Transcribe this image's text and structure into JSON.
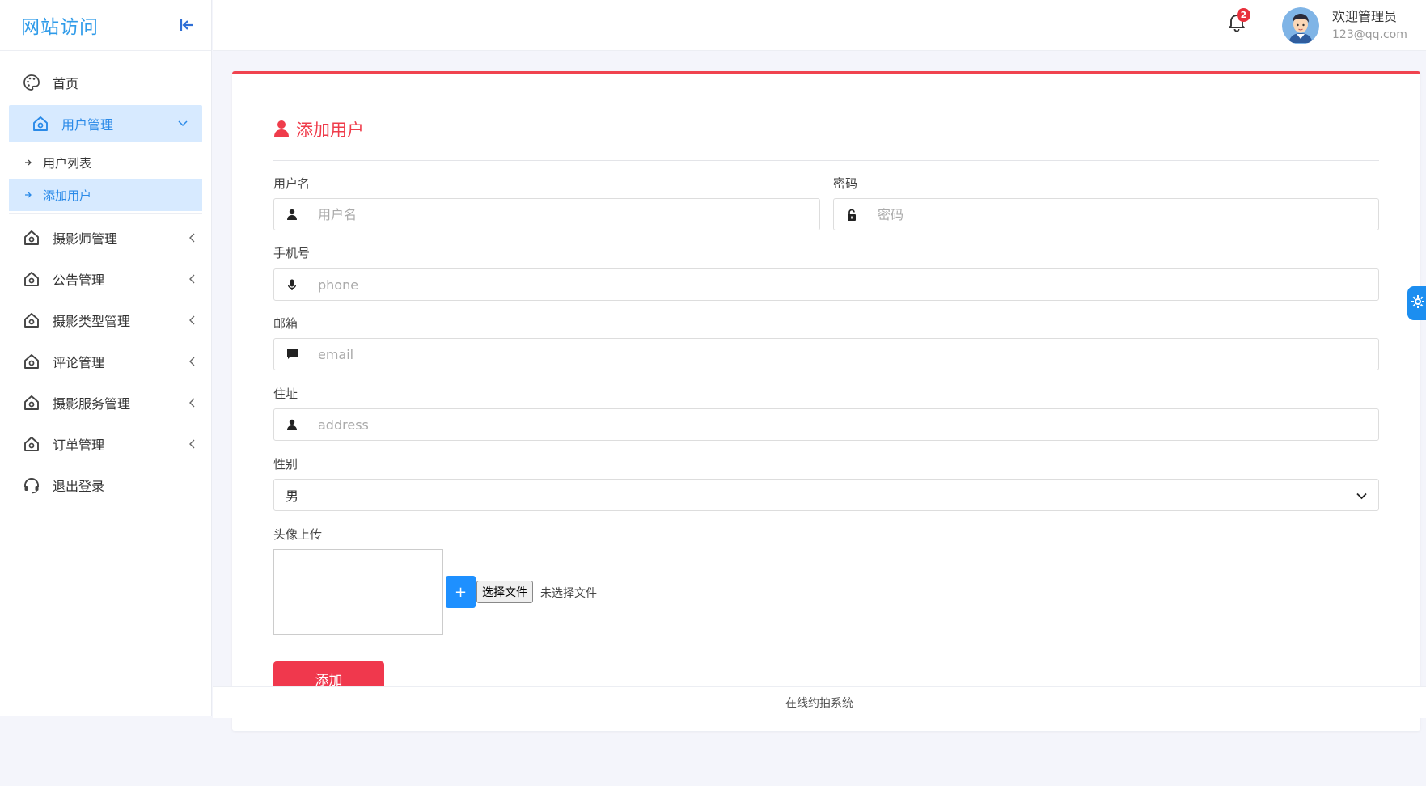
{
  "brand": {
    "title": "网站访问"
  },
  "sidebar": {
    "items": [
      {
        "label": "首页",
        "icon": "palette-icon"
      },
      {
        "label": "用户管理",
        "icon": "home-icon",
        "expanded": true,
        "children": [
          {
            "label": "用户列表"
          },
          {
            "label": "添加用户",
            "active": true
          }
        ]
      },
      {
        "label": "摄影师管理",
        "icon": "home-icon"
      },
      {
        "label": "公告管理",
        "icon": "home-icon"
      },
      {
        "label": "摄影类型管理",
        "icon": "home-icon"
      },
      {
        "label": "评论管理",
        "icon": "home-icon"
      },
      {
        "label": "摄影服务管理",
        "icon": "home-icon"
      },
      {
        "label": "订单管理",
        "icon": "home-icon"
      },
      {
        "label": "退出登录",
        "icon": "headset-icon"
      }
    ]
  },
  "header": {
    "notifications": "2",
    "user": {
      "name": "欢迎管理员",
      "email": "123@qq.com"
    }
  },
  "form": {
    "title": "添加用户",
    "username": {
      "label": "用户名",
      "placeholder": "用户名"
    },
    "password": {
      "label": "密码",
      "placeholder": "密码"
    },
    "phone": {
      "label": "手机号",
      "placeholder": "phone"
    },
    "email": {
      "label": "邮箱",
      "placeholder": "email"
    },
    "address": {
      "label": "住址",
      "placeholder": "address"
    },
    "gender": {
      "label": "性别",
      "value": "男"
    },
    "avatar": {
      "label": "头像上传",
      "plus": "+",
      "choose_file": "选择文件",
      "no_file": "未选择文件"
    },
    "submit": "添加"
  },
  "footer": {
    "text": "在线约拍系统"
  },
  "colors": {
    "accent_red": "#f0384d",
    "accent_blue": "#2f9be9",
    "active_bg": "#d7eaff"
  }
}
